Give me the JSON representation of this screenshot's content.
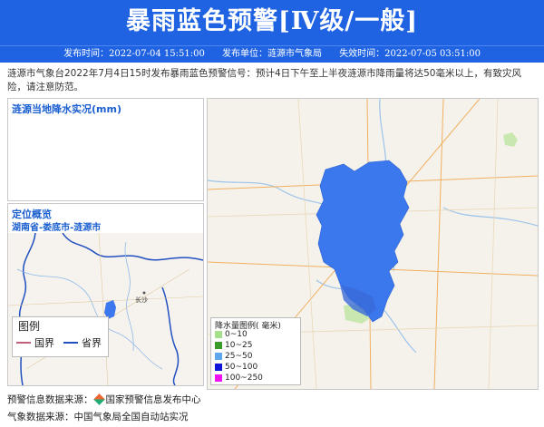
{
  "header": {
    "title": "暴雨蓝色预警[Ⅳ级/一般]",
    "publish_time": "发布时间：2022-07-04 15:51:00",
    "publisher": "发布单位：涟源市气象局",
    "expire_time": "失效时间：2022-07-05 03:51:00"
  },
  "description": "涟源市气象台2022年7月4日15时发布暴雨蓝色预警信号：预计4日下午至上半夜涟源市降雨量将达50毫米以上，有致灾风险，请注意防范。",
  "rain_panel": {
    "title": "涟源当地降水实况(mm)"
  },
  "location_panel": {
    "title": "定位概览",
    "region": "湖南省-娄底市-涟源市",
    "city_label": "长沙",
    "legend": {
      "title": "图例",
      "items": [
        {
          "label": "国界",
          "color": "#c0607a"
        },
        {
          "label": "省界",
          "color": "#2050c0"
        }
      ]
    }
  },
  "map": {
    "warning_area_color": "#3b78ee",
    "rain_legend": {
      "title": "降水量图例( 毫米)",
      "items": [
        {
          "label": "0~10",
          "color": "#a6e08a"
        },
        {
          "label": "10~25",
          "color": "#3a9a2a"
        },
        {
          "label": "25~50",
          "color": "#5fa6f0"
        },
        {
          "label": "50~100",
          "color": "#1016d8"
        },
        {
          "label": "100~250",
          "color": "#f012f0"
        }
      ]
    }
  },
  "footer": {
    "warning_source_label": "预警信息数据来源：",
    "warning_source": "国家预警信息发布中心",
    "weather_source": "气象数据来源：中国气象局全国自动站实况"
  }
}
